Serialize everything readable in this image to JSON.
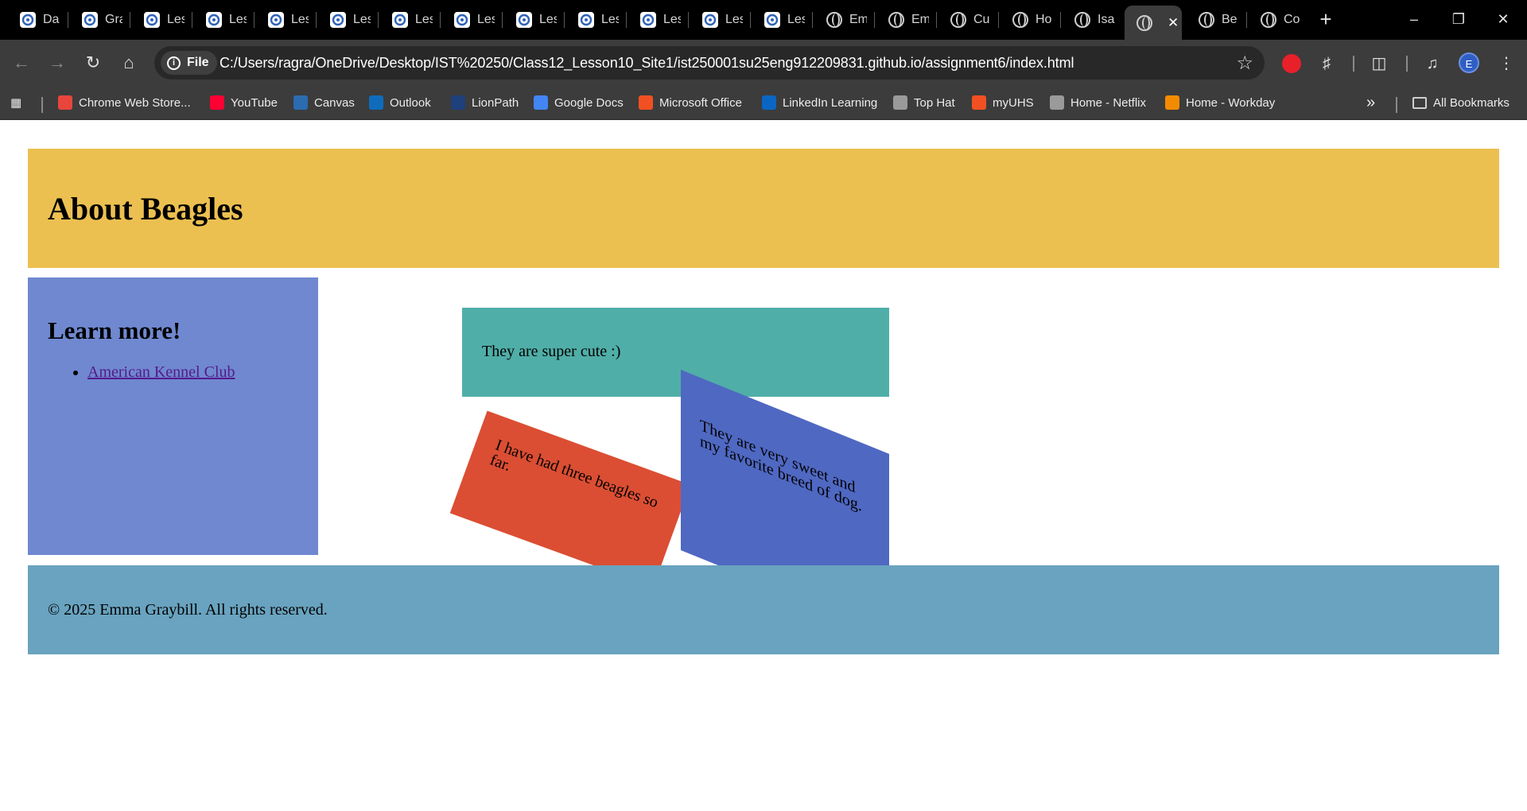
{
  "browser": {
    "tabs": [
      {
        "label": "Da",
        "icon": "canvas-app-icon"
      },
      {
        "label": "Gra",
        "icon": "canvas-app-icon"
      },
      {
        "label": "Les",
        "icon": "canvas-app-icon"
      },
      {
        "label": "Les",
        "icon": "canvas-app-icon"
      },
      {
        "label": "Les",
        "icon": "canvas-app-icon"
      },
      {
        "label": "Les",
        "icon": "canvas-app-icon"
      },
      {
        "label": "Les",
        "icon": "canvas-app-icon"
      },
      {
        "label": "Les",
        "icon": "canvas-app-icon"
      },
      {
        "label": "Les",
        "icon": "canvas-app-icon"
      },
      {
        "label": "Les",
        "icon": "canvas-app-icon"
      },
      {
        "label": "Les",
        "icon": "canvas-app-icon"
      },
      {
        "label": "Les",
        "icon": "canvas-app-icon"
      },
      {
        "label": "Les",
        "icon": "canvas-app-icon"
      },
      {
        "label": "Em",
        "icon": "globe-icon"
      },
      {
        "label": "Em",
        "icon": "globe-icon"
      },
      {
        "label": "Cu",
        "icon": "globe-icon"
      },
      {
        "label": "Ho",
        "icon": "globe-icon"
      },
      {
        "label": "Isa",
        "icon": "globe-icon"
      },
      {
        "label": "",
        "icon": "globe-icon",
        "active": true
      },
      {
        "label": "Be",
        "icon": "globe-icon"
      },
      {
        "label": "Co",
        "icon": "globe-icon"
      }
    ],
    "site_chip": "File",
    "url": "C:/Users/ragra/OneDrive/Desktop/IST%20250/Class12_Lesson10_Site1/ist250001su25eng912209831.github.io/assignment6/index.html",
    "profile_initial": "E",
    "bookmarks": [
      {
        "label": "Chrome Web Store...",
        "color": "#e8453c"
      },
      {
        "label": "YouTube",
        "color": "#ff0033"
      },
      {
        "label": "Canvas",
        "color": "#2b6cb0"
      },
      {
        "label": "Outlook",
        "color": "#0f6cbd"
      },
      {
        "label": "LionPath",
        "color": "#1e407c"
      },
      {
        "label": "Google Docs",
        "color": "#4285f4"
      },
      {
        "label": "Microsoft Office",
        "color": "#f25022"
      },
      {
        "label": "LinkedIn Learning",
        "color": "#0a66c2"
      },
      {
        "label": "Top Hat",
        "color": "#9a9a9a"
      },
      {
        "label": "myUHS",
        "color": "#f25022"
      },
      {
        "label": "Home - Netflix",
        "color": "#9a9a9a"
      },
      {
        "label": "Home - Workday",
        "color": "#f38b00"
      }
    ],
    "all_bookmarks": "All Bookmarks",
    "colors": {
      "frame": "#000000",
      "toolbar": "#3c3c3c",
      "omnibox": "#282828"
    }
  },
  "page": {
    "header_title": "About Beagles",
    "sidebar": {
      "title": "Learn more!",
      "links": [
        "American Kennel Club"
      ]
    },
    "cards": {
      "teal": "They are super cute :)",
      "orange": "I have had three beagles so far.",
      "blue": "They are very sweet and my favorite breed of dog."
    },
    "footer": "© 2025 Emma Graybill. All rights reserved.",
    "colors": {
      "header": "#ecc050",
      "sidebar": "#6f88d0",
      "teal_card": "#50aea8",
      "orange_card": "#db4e33",
      "blue_card": "#4f68c2",
      "footer": "#69a3bf",
      "link": "#551a8b"
    }
  }
}
